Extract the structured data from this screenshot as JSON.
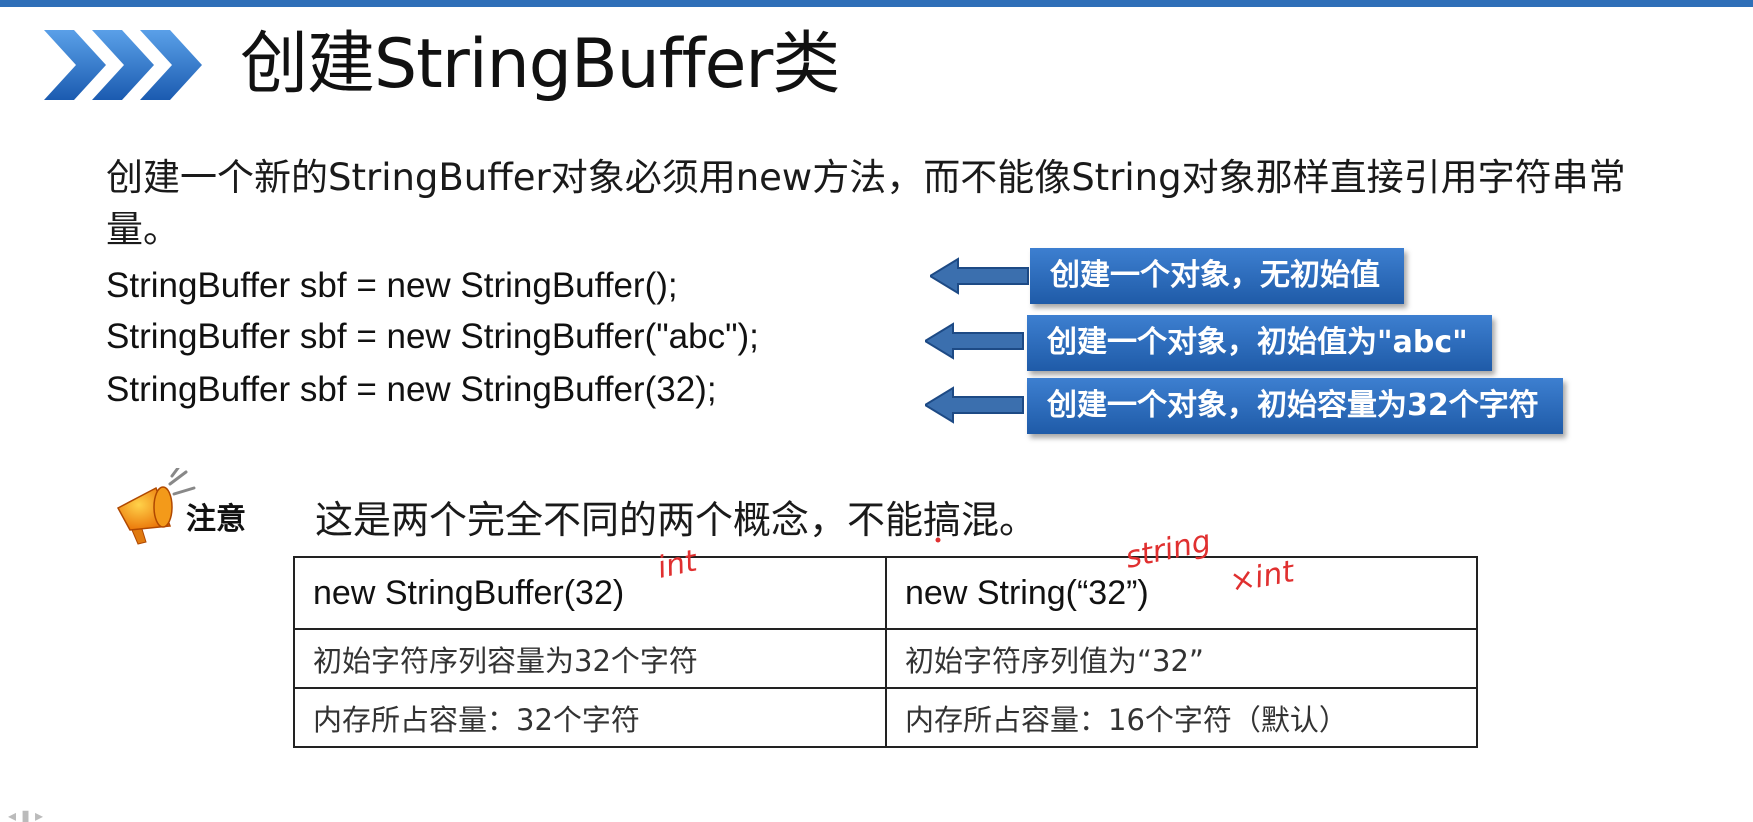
{
  "title": "创建StringBuffer类",
  "intro": "创建一个新的StringBuffer对象必须用new方法，而不能像String对象那样直接引用字符串常量。",
  "code_lines": [
    "StringBuffer sbf = new StringBuffer();",
    "StringBuffer sbf = new StringBuffer(\"abc\");",
    "StringBuffer sbf = new StringBuffer(32);"
  ],
  "callouts": [
    "创建一个对象，无初始值",
    "创建一个对象，初始值为\"abc\"",
    "创建一个对象，初始容量为32个字符"
  ],
  "note": {
    "label": "注意",
    "text": "这是两个完全不同的两个概念，不能搞混。"
  },
  "table": {
    "headers": [
      "new StringBuffer(32)",
      "new String(“32”)"
    ],
    "rows": [
      [
        "初始字符序列容量为32个字符",
        "初始字符序列值为“32”"
      ],
      [
        "内存所占容量：32个字符",
        "内存所占容量：16个字符（默认）"
      ]
    ]
  },
  "handwriting": {
    "annotation_1": "int",
    "annotation_2": "string",
    "annotation_3": "×int"
  },
  "colors": {
    "accent_blue": "#2f6fb8",
    "callout_blue": "#2a6cc0",
    "ink_red": "#e03030"
  }
}
